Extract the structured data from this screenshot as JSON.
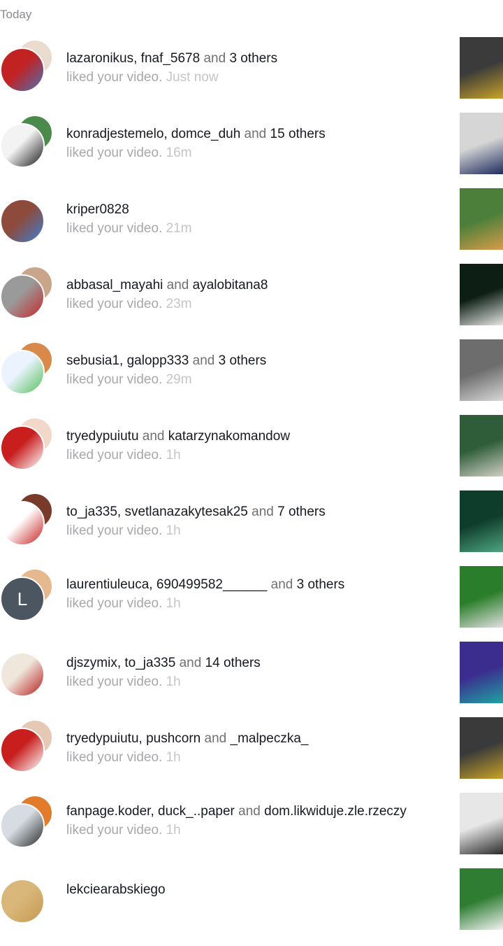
{
  "section_title": "Today",
  "liked_text": "liked your video.",
  "items": [
    {
      "names": "lazaronikus, fnaf_5678",
      "join": " and ",
      "extra": "3 others",
      "time": "Just now",
      "back_color": "#e9dccf",
      "front_colors": [
        "#c32222",
        "#4d6fb0"
      ],
      "thumb_colors": [
        "#3b3b3b",
        "#c9a227"
      ]
    },
    {
      "names": "konradjestemelo, domce_duh",
      "join": " and ",
      "extra": "15 others",
      "time": "16m",
      "back_color": "#4a8a4a",
      "front_colors": [
        "#f3f3f3",
        "#1a1a1a"
      ],
      "thumb_colors": [
        "#d6d6d6",
        "#1e2c5e"
      ]
    },
    {
      "names": "kriper0828",
      "join": "",
      "extra": "",
      "time": "21m",
      "back_color": "",
      "front_colors": [
        "#8e4a3a",
        "#3b7fd0"
      ],
      "thumb_colors": [
        "#4b7f3a",
        "#d89c4a"
      ]
    },
    {
      "names": "abbasal_mayahi",
      "join": " and ",
      "extra": "ayalobitana8",
      "time": "23m",
      "back_color": "#c9a58a",
      "front_colors": [
        "#9a9a9a",
        "#c62828"
      ],
      "thumb_colors": [
        "#0d1f14",
        "#e6e6e6"
      ]
    },
    {
      "names": "sebusia1, galopp333",
      "join": " and ",
      "extra": "3 others",
      "time": "29m",
      "back_color": "#d98a4a",
      "front_colors": [
        "#eaf3ff",
        "#57c15a"
      ],
      "thumb_colors": [
        "#6d6d6d",
        "#d8d8d8"
      ]
    },
    {
      "names": "tryedypuiutu",
      "join": " and ",
      "extra": "katarzynakomandow",
      "time": "1h",
      "back_color": "#f2d8c8",
      "front_colors": [
        "#c81e1e",
        "#ffffff"
      ],
      "thumb_colors": [
        "#2f5d3a",
        "#cfcfc4"
      ]
    },
    {
      "names": "to_ja335, svetlanazakytesak25",
      "join": " and ",
      "extra": "7 others",
      "time": "1h",
      "back_color": "#7a3a2a",
      "front_colors": [
        "#ffffff",
        "#c81e1e"
      ],
      "thumb_colors": [
        "#0f3d2b",
        "#4ea582"
      ]
    },
    {
      "names": "laurentiuleuca, 690499582______",
      "join": " and ",
      "extra": "3 others",
      "time": "1h",
      "back_color": "#e6b88e",
      "front_colors": [
        "#4b5660",
        "#4b5660"
      ],
      "thumb_colors": [
        "#2a7d2a",
        "#e0e0e0"
      ],
      "letter": "L"
    },
    {
      "names": "djszymix, to_ja335",
      "join": " and ",
      "extra": "14 others",
      "time": "1h",
      "back_color": "#ffffff",
      "front_colors": [
        "#efe7dc",
        "#b71c1c"
      ],
      "thumb_colors": [
        "#3b2d8e",
        "#1fa3a3"
      ]
    },
    {
      "names": "tryedypuiutu, pushcorn",
      "join": " and ",
      "extra": "_malpeczka_",
      "time": "1h",
      "back_color": "#e5c9b4",
      "front_colors": [
        "#c81e1e",
        "#ffffff"
      ],
      "thumb_colors": [
        "#3a3a3a",
        "#c9a227"
      ]
    },
    {
      "names": "fanpage.koder, duck_..paper",
      "join": " and ",
      "extra": "dom.likwiduje.zle.rzeczy",
      "time": "1h",
      "back_color": "#e27b2a",
      "front_colors": [
        "#d6dce2",
        "#2a2a2a"
      ],
      "thumb_colors": [
        "#e7e7e7",
        "#2a2a2a"
      ]
    },
    {
      "names": "lekciearabskiego",
      "join": "",
      "extra": "",
      "time": "",
      "back_color": "",
      "front_colors": [
        "#d9b77a",
        "#c59a52"
      ],
      "thumb_colors": [
        "#2e7d32",
        "#f2f2f2"
      ]
    }
  ],
  "icons": [
    "avatar",
    "video-thumbnail"
  ]
}
